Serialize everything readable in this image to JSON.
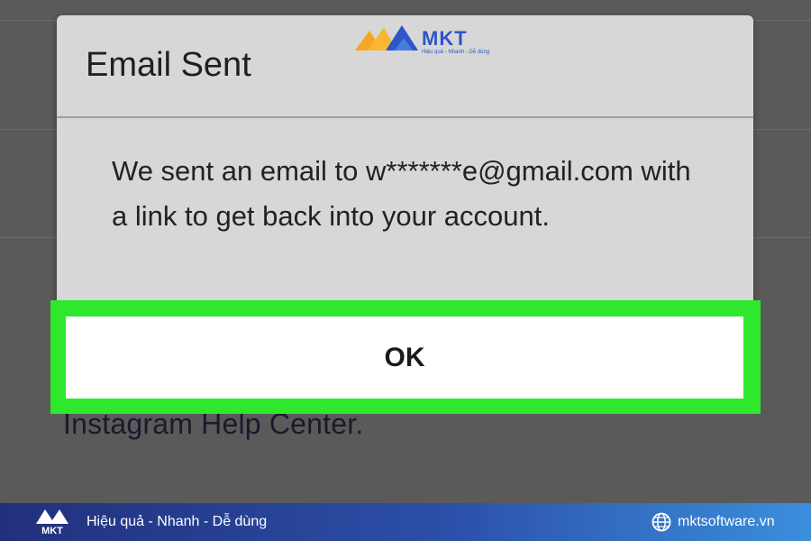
{
  "background": {
    "help_text": "Instagram Help Center."
  },
  "dialog": {
    "title": "Email Sent",
    "message": "We sent an email to w*******e@gmail.com with a link to get back into your account.",
    "ok_label": "OK",
    "highlight_color": "#2EE82E"
  },
  "watermark": {
    "brand": "MKT",
    "tagline": "Hiệu quả - Nhanh - Dễ dùng"
  },
  "footer": {
    "brand": "MKT",
    "slogan": "Hiệu quả - Nhanh - Dễ dùng",
    "website": "mktsoftware.vn",
    "globe_icon": "globe-icon"
  },
  "colors": {
    "brand_blue": "#2D56C9",
    "brand_orange": "#F5A623",
    "footer_dark": "#21307C",
    "footer_light": "#3A8FDC"
  }
}
